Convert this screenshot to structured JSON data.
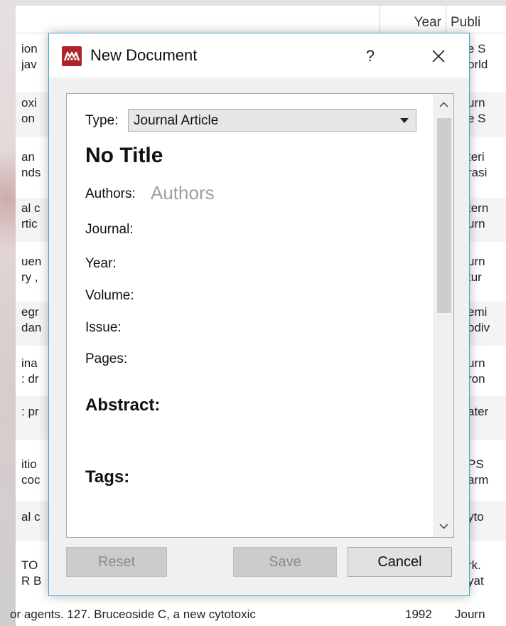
{
  "background": {
    "header": {
      "year": "Year",
      "publication": "Publi"
    },
    "rows": [
      {
        "left": [
          "ion",
          "jav"
        ],
        "right": [
          "e S",
          "orld"
        ]
      },
      {
        "left": [
          "oxi",
          "on"
        ],
        "right": [
          "urn",
          "e S"
        ]
      },
      {
        "left": [
          "an",
          "nds"
        ],
        "right": [
          "teri",
          "rasi"
        ]
      },
      {
        "left": [
          "al c",
          "rtic"
        ],
        "right": [
          "tern",
          "urn"
        ]
      },
      {
        "left": [
          "uen",
          "ry ,"
        ],
        "right": [
          "urn",
          "tur"
        ]
      },
      {
        "left": [
          "egr",
          "dan"
        ],
        "right": [
          "emi",
          "odiv"
        ]
      },
      {
        "left": [
          "ina",
          ": dr"
        ],
        "right": [
          "urn",
          "ron"
        ]
      },
      {
        "left": [
          ": pr",
          ""
        ],
        "right": [
          "ater",
          ""
        ]
      },
      {
        "left": [
          "itio",
          "coc"
        ],
        "right": [
          "PS",
          "arm"
        ]
      },
      {
        "left": [
          "al c",
          ""
        ],
        "right": [
          "yto",
          ""
        ]
      },
      {
        "left": [
          "TO",
          "R B"
        ],
        "right": [
          "rk.",
          "yat"
        ]
      }
    ],
    "last_row": {
      "title": "or agents. 127. Bruceoside C, a new cytotoxic",
      "year": "1992",
      "publication": "Journ"
    }
  },
  "dialog": {
    "title": "New Document",
    "help_label": "?",
    "accent_color": "#47a8c2",
    "app_icon": "mendeley-logo-icon",
    "form": {
      "type_label": "Type:",
      "type_value": "Journal Article",
      "doc_title": "No Title",
      "authors_label": "Authors:",
      "authors_placeholder": "Authors",
      "journal_label": "Journal:",
      "year_label": "Year:",
      "volume_label": "Volume:",
      "issue_label": "Issue:",
      "pages_label": "Pages:",
      "abstract_heading": "Abstract:",
      "tags_heading": "Tags:"
    },
    "buttons": {
      "reset": "Reset",
      "save": "Save",
      "cancel": "Cancel"
    }
  }
}
